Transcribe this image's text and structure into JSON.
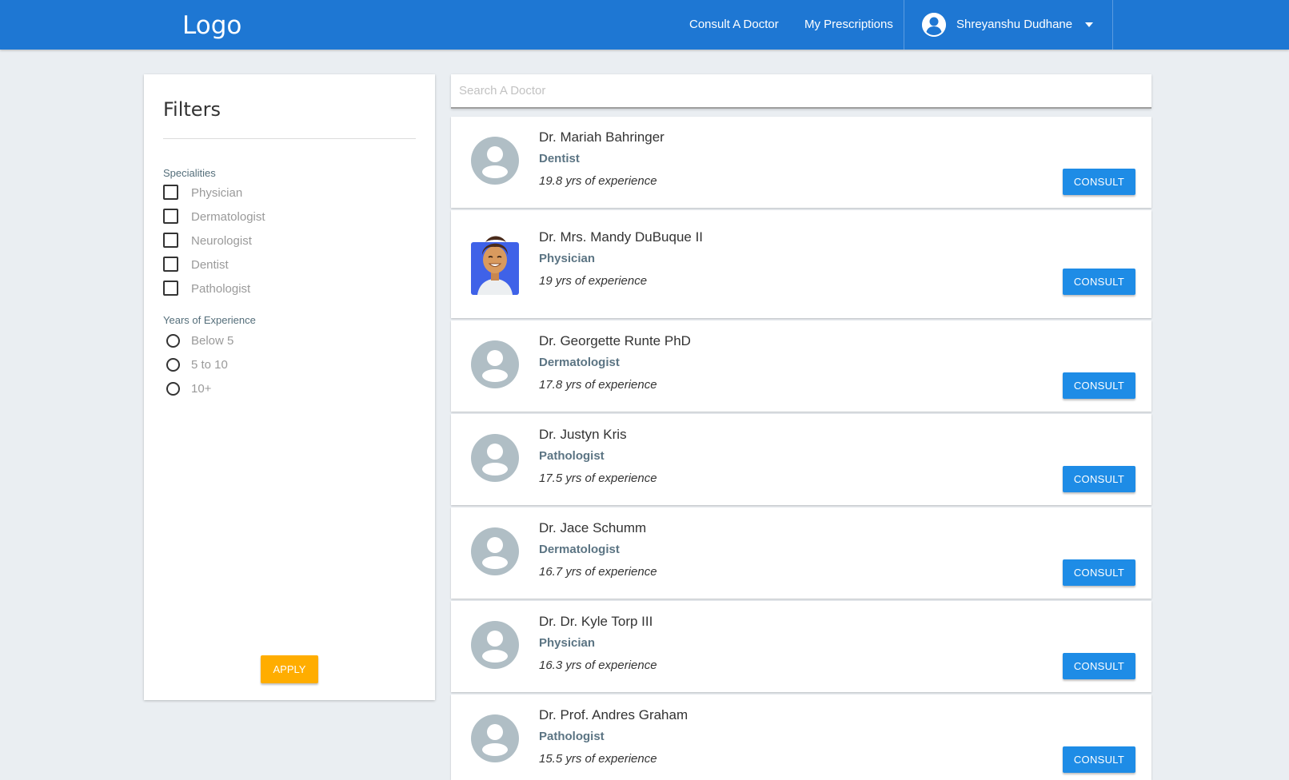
{
  "header": {
    "logo": "Logo",
    "nav": {
      "consult": "Consult A Doctor",
      "prescriptions": "My Prescriptions"
    },
    "user": {
      "name": "Shreyanshu Dudhane",
      "icon": "account-circle-icon"
    },
    "color": "#1e77d3"
  },
  "filters": {
    "title": "Filters",
    "specialities_label": "Specialities",
    "specialities": [
      "Physician",
      "Dermatologist",
      "Neurologist",
      "Dentist",
      "Pathologist"
    ],
    "experience_label": "Years of Experience",
    "experience": [
      "Below 5",
      "5 to 10",
      "10+"
    ],
    "apply_label": "APPLY",
    "apply_color": "#ffad00"
  },
  "search": {
    "placeholder": "Search A Doctor"
  },
  "doctors": [
    {
      "name": "Dr. Mariah Bahringer",
      "speciality": "Dentist",
      "experience": "19.8 yrs of experience",
      "avatar": "default-avatar-icon",
      "button": "CONSULT"
    },
    {
      "name": "Dr. Mrs. Mandy DuBuque II",
      "speciality": "Physician",
      "experience": "19 yrs of experience",
      "avatar": "person-photo-avatar",
      "button": "CONSULT"
    },
    {
      "name": "Dr. Georgette Runte PhD",
      "speciality": "Dermatologist",
      "experience": "17.8 yrs of experience",
      "avatar": "default-avatar-icon",
      "button": "CONSULT"
    },
    {
      "name": "Dr. Justyn Kris",
      "speciality": "Pathologist",
      "experience": "17.5 yrs of experience",
      "avatar": "default-avatar-icon",
      "button": "CONSULT"
    },
    {
      "name": "Dr. Jace Schumm",
      "speciality": "Dermatologist",
      "experience": "16.7 yrs of experience",
      "avatar": "default-avatar-icon",
      "button": "CONSULT"
    },
    {
      "name": "Dr. Dr. Kyle Torp III",
      "speciality": "Physician",
      "experience": "16.3 yrs of experience",
      "avatar": "default-avatar-icon",
      "button": "CONSULT"
    },
    {
      "name": "Dr. Prof. Andres Graham",
      "speciality": "Pathologist",
      "experience": "15.5 yrs of experience",
      "avatar": "default-avatar-icon",
      "button": "CONSULT"
    }
  ],
  "consult_color": "#1e8ce6"
}
